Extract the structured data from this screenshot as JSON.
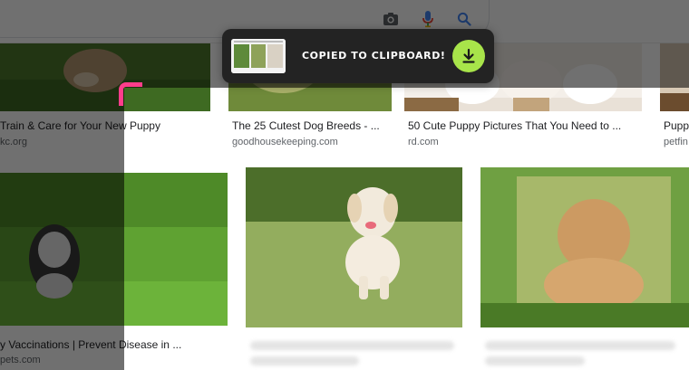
{
  "search": {
    "camera_icon": "camera-icon",
    "mic_icon": "microphone-icon",
    "search_icon": "search-icon"
  },
  "results": [
    {
      "title": "Train & Care for Your New Puppy",
      "source": "kc.org"
    },
    {
      "title": "The 25 Cutest Dog Breeds - ...",
      "source": "goodhousekeeping.com"
    },
    {
      "title": "50 Cute Puppy Pictures That You Need to ...",
      "source": "rd.com"
    },
    {
      "title": "Pupp",
      "source": "petfin"
    },
    {
      "title": "y Vaccinations | Prevent Disease in ...",
      "source": "pets.com"
    }
  ],
  "toast": {
    "message": "COPIED TO CLIPBOARD!",
    "button_icon": "download-icon"
  },
  "colors": {
    "toast_bg": "#232323",
    "toast_button": "#a8e44a",
    "corner_marker": "#ff3d8b",
    "overlay": "rgba(0,0,0,0.56)"
  }
}
